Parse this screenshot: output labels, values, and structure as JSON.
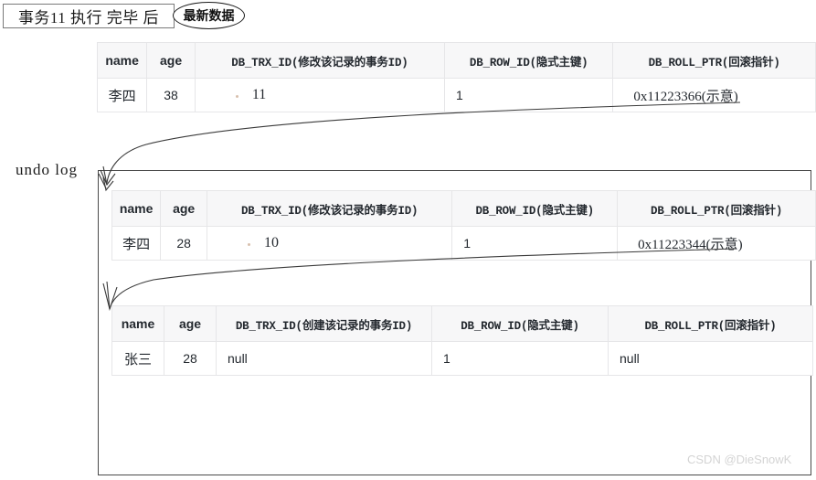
{
  "header": {
    "title": "事务11 执行 完毕 后",
    "badge_label": "最新数据"
  },
  "undo_log": {
    "label": "undo log"
  },
  "columns_modified": {
    "name": "name",
    "age": "age",
    "trx_id": "DB_TRX_ID(修改该记录的事务ID)",
    "row_id": "DB_ROW_ID(隐式主键)",
    "roll_ptr": "DB_ROLL_PTR(回滚指针)"
  },
  "columns_created": {
    "name": "name",
    "age": "age",
    "trx_id": "DB_TRX_ID(创建该记录的事务ID)",
    "row_id": "DB_ROW_ID(隐式主键)",
    "roll_ptr": "DB_ROLL_PTR(回滚指针)"
  },
  "tables": [
    {
      "id": "latest-record",
      "row": {
        "name": "李四",
        "age": "38",
        "trx_id": "11",
        "row_id": "1",
        "roll_ptr": "0x11223366(示意)"
      }
    },
    {
      "id": "undo-version-1",
      "row": {
        "name": "李四",
        "age": "28",
        "trx_id": "10",
        "row_id": "1",
        "roll_ptr": "0x11223344(示意)"
      }
    },
    {
      "id": "undo-version-2",
      "row": {
        "name": "张三",
        "age": "28",
        "trx_id": "null",
        "row_id": "1",
        "roll_ptr": "null"
      }
    }
  ],
  "arrows": [
    {
      "name": "roll-ptr-arrow-1",
      "from": "latest-record.roll_ptr",
      "to": "undo-version-1"
    },
    {
      "name": "roll-ptr-arrow-2",
      "from": "undo-version-1.roll_ptr",
      "to": "undo-version-2"
    }
  ],
  "watermark": {
    "text": "CSDN @DieSnowK"
  },
  "colors": {
    "table_border": "#e6e6e8",
    "header_bg": "#f7f7f8",
    "box_border": "#4a4a4a",
    "text": "#24292f",
    "watermark": "#d4d4d4"
  }
}
